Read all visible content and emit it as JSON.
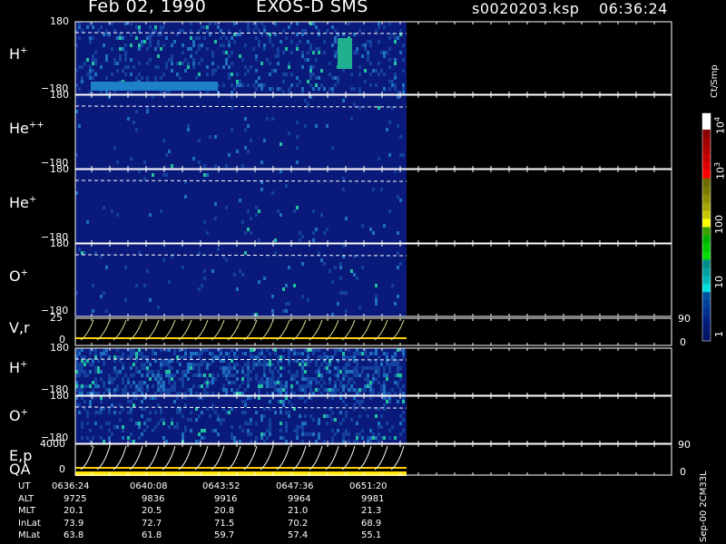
{
  "header": {
    "date": "Feb 02, 1990",
    "instrument": "EXOS-D SMS",
    "filename": "s0020203.ksp",
    "time": "06:36:24"
  },
  "panels": [
    {
      "key": "h1",
      "label": "H",
      "sup": "+",
      "ytop": "180",
      "ybot": "−180"
    },
    {
      "key": "he2",
      "label": "He",
      "sup": "++",
      "ytop": "180",
      "ybot": "−180"
    },
    {
      "key": "he1",
      "label": "He",
      "sup": "+",
      "ytop": "180",
      "ybot": "−180"
    },
    {
      "key": "o1",
      "label": "O",
      "sup": "+",
      "ytop": "180",
      "ybot": "−180"
    },
    {
      "key": "vr",
      "label": "V,r",
      "sup": "",
      "ytop": "25",
      "ybot": "0",
      "rtop": "90",
      "rbot": "0"
    },
    {
      "key": "h2",
      "label": "H",
      "sup": "+",
      "ytop": "180",
      "ybot": "−180"
    },
    {
      "key": "o2",
      "label": "O",
      "sup": "+",
      "ytop": "180",
      "ybot": "−180"
    },
    {
      "key": "ep",
      "label": "E,p",
      "sup": "",
      "label2": "QA",
      "ytop": "4000",
      "ybot": "0",
      "rtop": "90",
      "rbot": "0"
    }
  ],
  "colorbar": {
    "unit": "Ct/Smp",
    "ticks": [
      {
        "base": "10",
        "exp": "4"
      },
      {
        "base": "10",
        "exp": "3"
      },
      {
        "base": "100",
        "exp": ""
      },
      {
        "base": "10",
        "exp": ""
      },
      {
        "base": "1",
        "exp": ""
      }
    ],
    "colors": [
      "#ffffff",
      "#ffffff",
      "#8b0000",
      "#a00000",
      "#b00000",
      "#c80000",
      "#e00000",
      "#ff0000",
      "#6b6b00",
      "#7a7a00",
      "#8f8f00",
      "#a6a600",
      "#c8c800",
      "#ffff00",
      "#3aa000",
      "#00b000",
      "#00c800",
      "#00dd00",
      "#008b8b",
      "#00a0a0",
      "#00b8b8",
      "#00dddd",
      "#0050a0",
      "#00409a",
      "#003090",
      "#002080",
      "#001a70",
      "#001464"
    ]
  },
  "chart_data": [
    {
      "type": "heatmap",
      "title": "H+",
      "ylim": [
        -180,
        180
      ],
      "x": [
        "0636:24",
        "0640:08",
        "0643:52",
        "0647:36",
        "0651:20"
      ]
    },
    {
      "type": "heatmap",
      "title": "He++",
      "ylim": [
        -180,
        180
      ]
    },
    {
      "type": "heatmap",
      "title": "He+",
      "ylim": [
        -180,
        180
      ]
    },
    {
      "type": "heatmap",
      "title": "O+",
      "ylim": [
        -180,
        180
      ]
    },
    {
      "type": "line",
      "title": "V,r",
      "ylim": [
        0,
        25
      ],
      "right_ylim": [
        0,
        90
      ]
    },
    {
      "type": "heatmap",
      "title": "H+",
      "ylim": [
        -180,
        180
      ]
    },
    {
      "type": "heatmap",
      "title": "O+",
      "ylim": [
        -180,
        180
      ]
    },
    {
      "type": "line",
      "title": "E,p",
      "ylim": [
        0,
        4000
      ],
      "right_ylim": [
        0,
        90
      ]
    }
  ],
  "table": {
    "rows": [
      {
        "label": "UT",
        "values": [
          "0636:24",
          "0640:08",
          "0643:52",
          "0647:36",
          "0651:20"
        ]
      },
      {
        "label": "ALT",
        "values": [
          "9725",
          "9836",
          "9916",
          "9964",
          "9981"
        ]
      },
      {
        "label": "MLT",
        "values": [
          "20.1",
          "20.5",
          "20.8",
          "21.0",
          "21.3"
        ]
      },
      {
        "label": "InLat",
        "values": [
          "73.9",
          "72.7",
          "71.5",
          "70.2",
          "68.9"
        ]
      },
      {
        "label": "MLat",
        "values": [
          "63.8",
          "61.8",
          "59.7",
          "57.4",
          "55.1"
        ]
      }
    ]
  },
  "footer_vertical": "Sep-00 2CM33L"
}
